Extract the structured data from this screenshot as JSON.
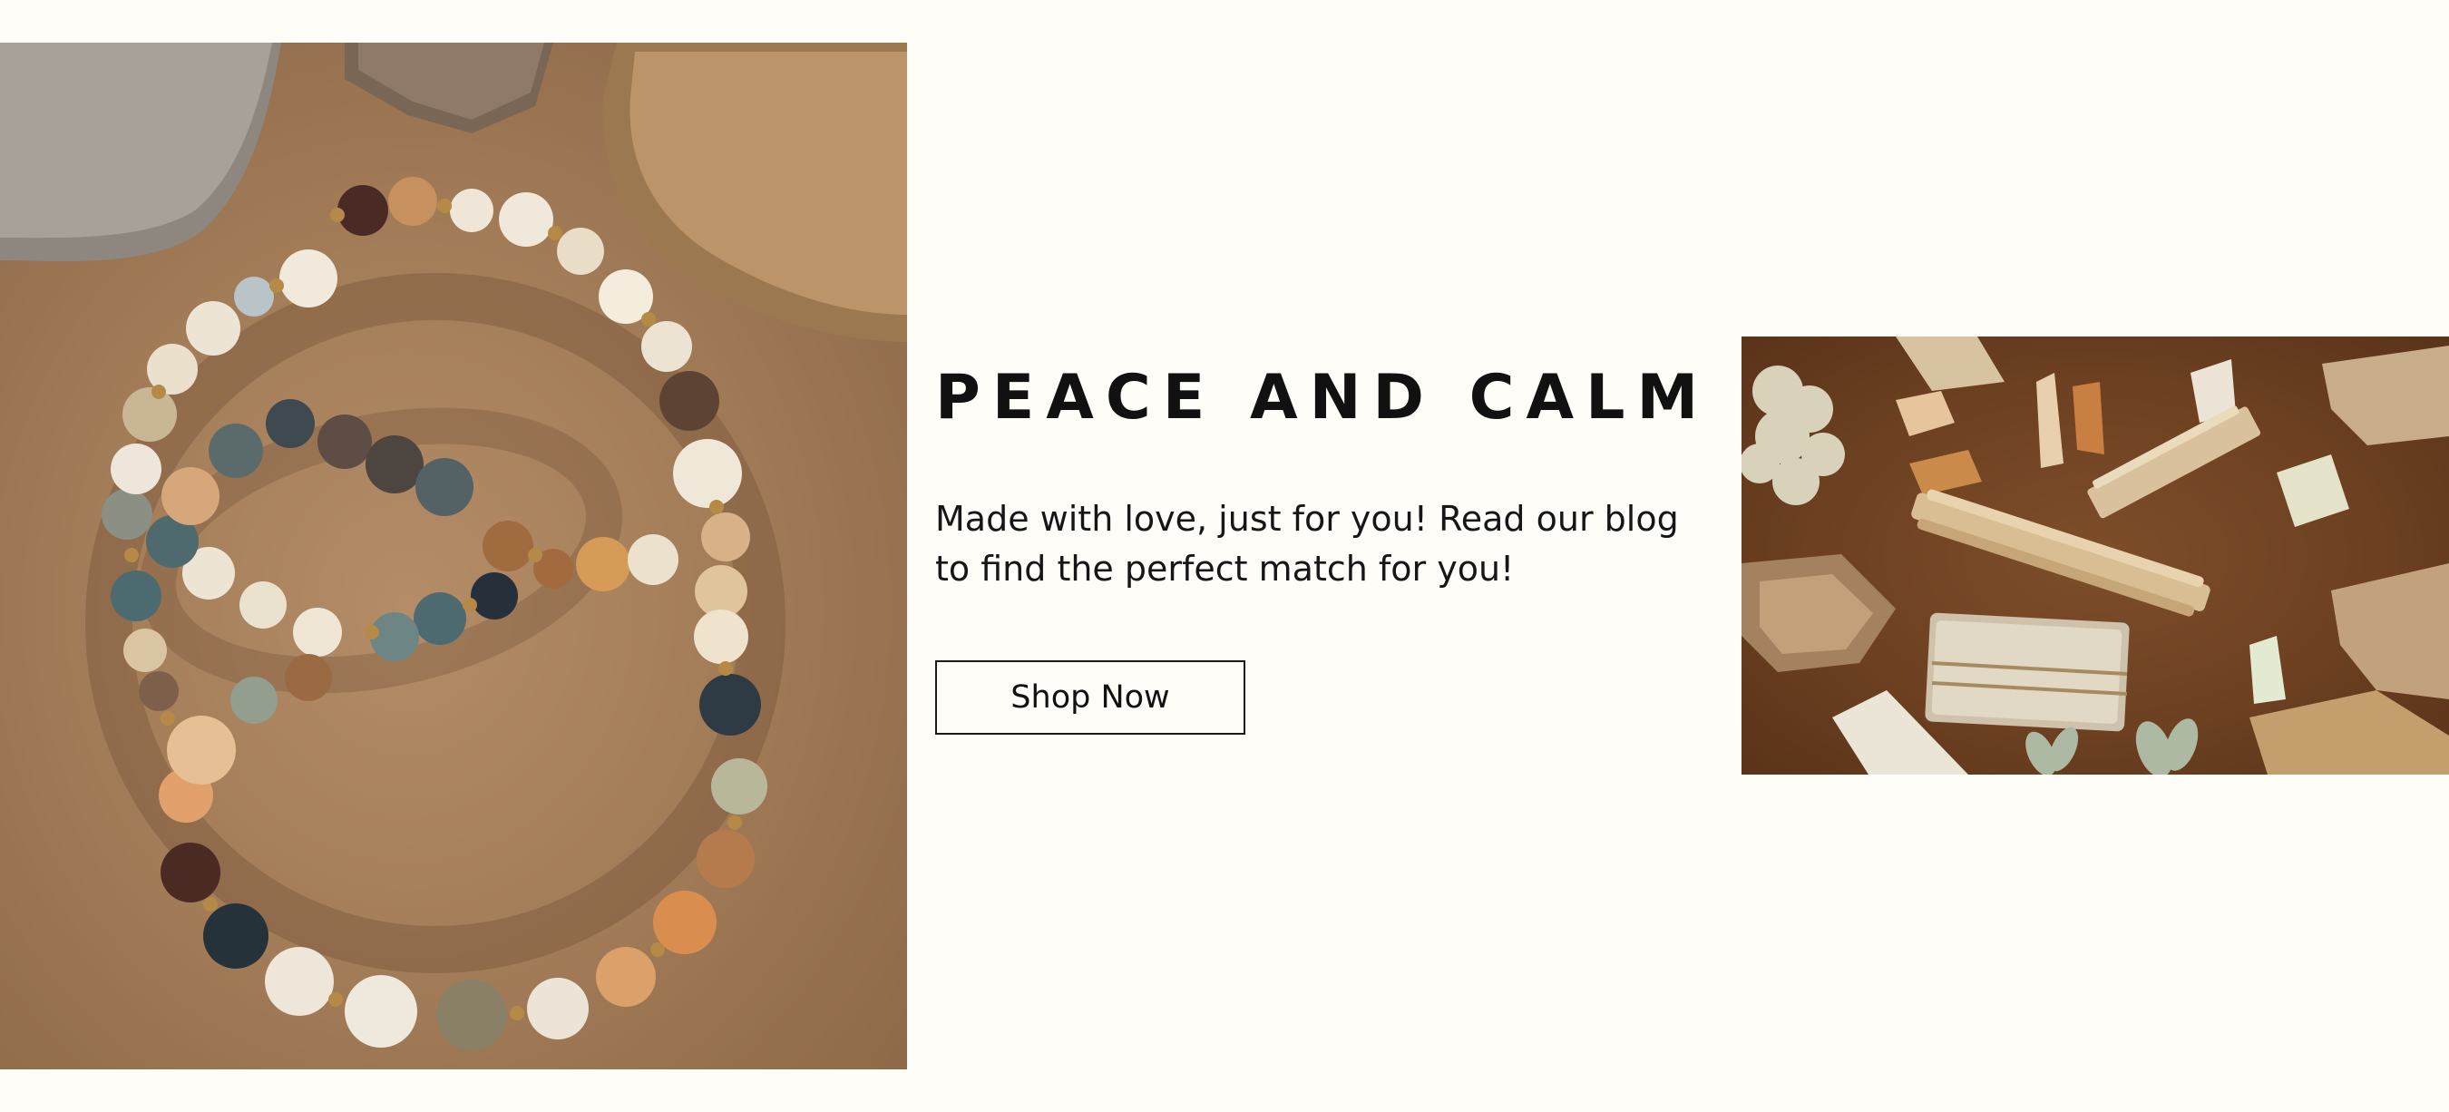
{
  "hero": {
    "headline": "PEACE AND CALM",
    "description": "Made with love, just for you! Read our blog to find the perfect match for you!",
    "cta_label": "Shop Now"
  },
  "images": {
    "left": "bracelets-photo",
    "right": "crystals-and-palo-santo-photo"
  },
  "colors": {
    "background": "#fffdf8",
    "text": "#111111",
    "button_border": "#1a1a1a"
  }
}
